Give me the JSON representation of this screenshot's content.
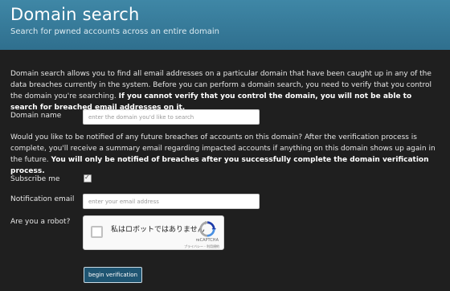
{
  "hero": {
    "title": "Domain search",
    "subtitle": "Search for pwned accounts across an entire domain"
  },
  "intro": {
    "text": "Domain search allows you to find all email addresses on a particular domain that have been caught up in any of the data breaches currently in the system. Before you can perform a domain search, you need to verify that you control the domain you're searching. ",
    "emphasis": "If you cannot verify that you control the domain, you will not be able to search for breached email addresses on it."
  },
  "form": {
    "domain_label": "Domain name",
    "domain_placeholder": "enter the domain you'd like to search",
    "domain_value": "",
    "notify_text": "Would you like to be notified of any future breaches of accounts on this domain? After the verification process is complete, you'll receive a summary email regarding impacted accounts if anything on this domain shows up again in the future. ",
    "notify_emphasis": "You will only be notified of breaches after you successfully complete the domain verification process.",
    "subscribe_label": "Subscribe me",
    "subscribe_checked": true,
    "email_label": "Notification email",
    "email_placeholder": "enter your email address",
    "email_value": "",
    "robot_label": "Are you a robot?",
    "submit_label": "begin verification"
  },
  "recaptcha": {
    "label": "私はロボットではありません",
    "brand": "reCAPTCHA",
    "terms": "プライバシー - 利用規約",
    "icon": "recaptcha-logo-icon"
  },
  "colors": {
    "background": "#1f1f1f",
    "hero_top": "#3f87a6",
    "hero_bottom": "#2f6f8e",
    "button_bg": "#1f5572",
    "text": "#e6e6e6"
  }
}
